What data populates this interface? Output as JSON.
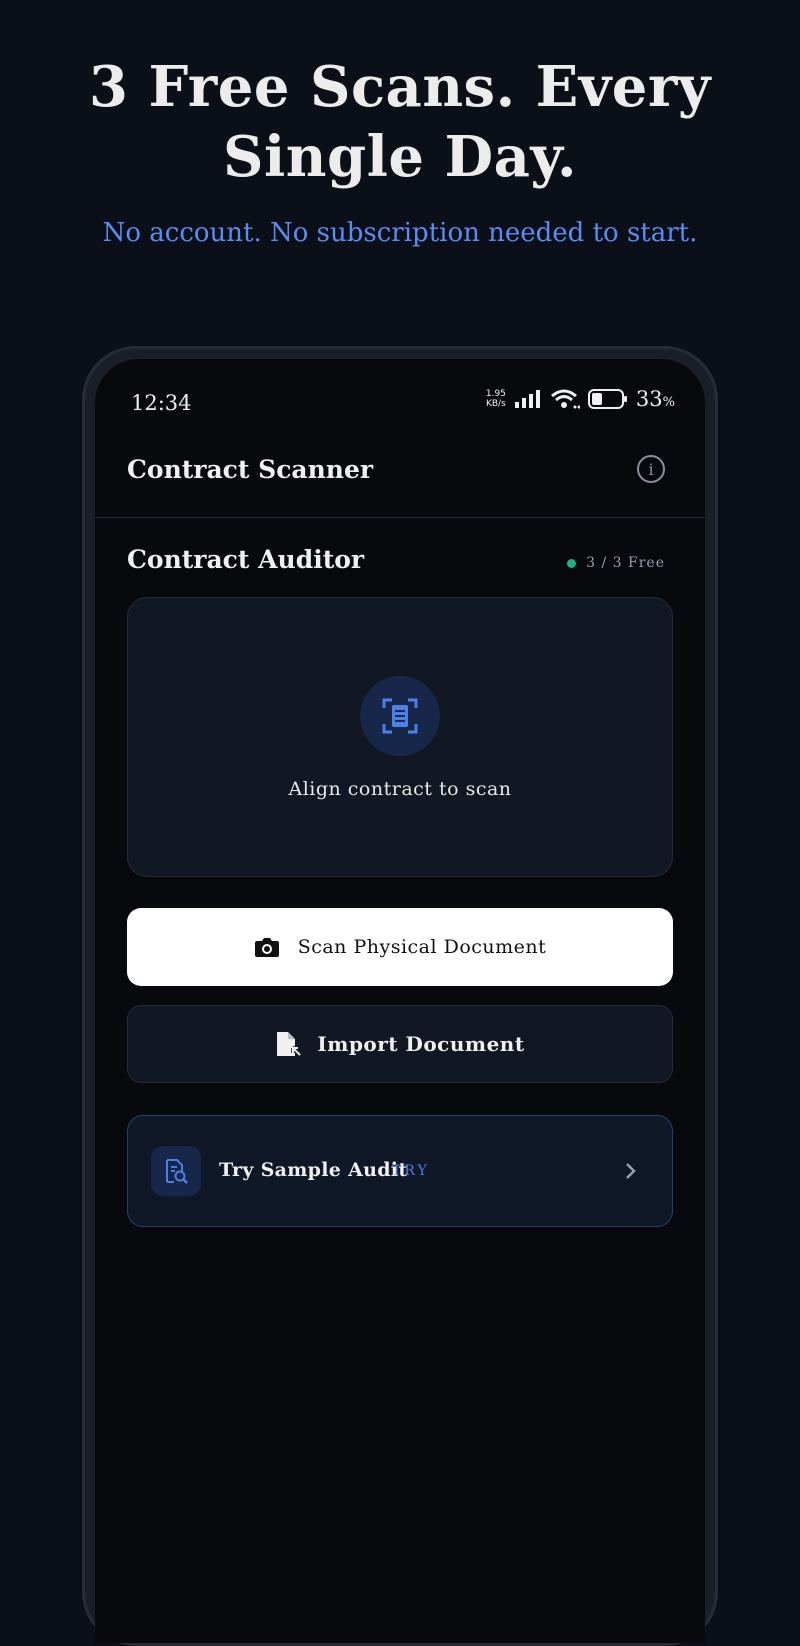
{
  "promo": {
    "headline_line1": "3 Free Scans. Every",
    "headline_line2": "Single Day.",
    "subline": "No account. No subscription needed to start."
  },
  "status_bar": {
    "time": "12:34",
    "net_speed_value": "1.95",
    "net_speed_unit": "KB/s",
    "battery_percent": "33",
    "battery_unit": "%"
  },
  "app_bar": {
    "title": "Contract Scanner",
    "info_icon": "info-icon"
  },
  "section": {
    "title": "Contract Auditor",
    "quota_label": "3 / 3 Free",
    "quota_color": "#19b383"
  },
  "scan_area": {
    "icon": "document-scan-icon",
    "caption": "Align contract to scan"
  },
  "actions": {
    "scan_label": "Scan Physical Document",
    "scan_icon": "camera-icon",
    "import_label": "Import Document",
    "import_icon": "file-import-icon"
  },
  "sample": {
    "label": "Try Sample Audit",
    "tag": "TRY",
    "icon": "document-search-icon",
    "accent": "#4d7fe8"
  }
}
